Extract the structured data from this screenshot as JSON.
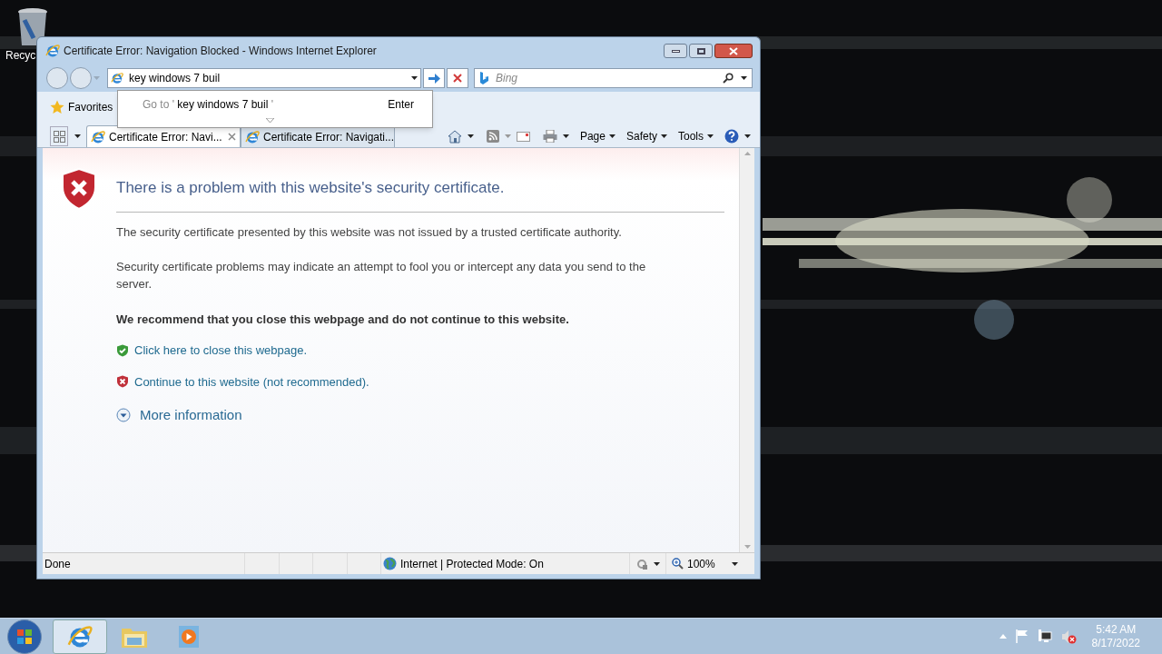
{
  "desktop": {
    "icons": [
      {
        "label": "Recyc"
      }
    ]
  },
  "window": {
    "title": "Certificate Error: Navigation Blocked - Windows Internet Explorer",
    "address": {
      "value": "key windows 7 buil"
    },
    "suggestion": {
      "prefix": "Go to '",
      "query": "key windows 7 buil",
      "suffix": "'",
      "action": "Enter"
    },
    "search": {
      "placeholder": "Bing"
    },
    "favorites": "Favorites",
    "tabs": [
      {
        "label": "Certificate Error: Navi...",
        "selected": true
      },
      {
        "label": "Certificate Error: Navigati...",
        "selected": false
      }
    ],
    "commands": [
      "Page",
      "Safety",
      "Tools"
    ],
    "page": {
      "heading": "There is a problem with this website's security certificate.",
      "paragraphs": [
        "The security certificate presented by this website was not issued by a trusted certificate authority.",
        "Security certificate problems may indicate an attempt to fool you or intercept any data you send to the server."
      ],
      "recommendation": "We recommend that you close this webpage and do not continue to this website.",
      "links": [
        {
          "kind": "safe",
          "text": "Click here to close this webpage."
        },
        {
          "kind": "unsafe",
          "text": "Continue to this website (not recommended)."
        }
      ],
      "more": "More information"
    },
    "status_bar": {
      "status": "Done",
      "zone": "Internet | Protected Mode: On",
      "zoom": "100%"
    }
  },
  "taskbar": {
    "items": [
      {
        "kind": "browser",
        "selected": true
      },
      {
        "kind": "folder",
        "selected": false
      },
      {
        "kind": "media",
        "selected": false
      }
    ],
    "clock": {
      "time": "5:42 AM",
      "date": "8/17/2022"
    }
  }
}
